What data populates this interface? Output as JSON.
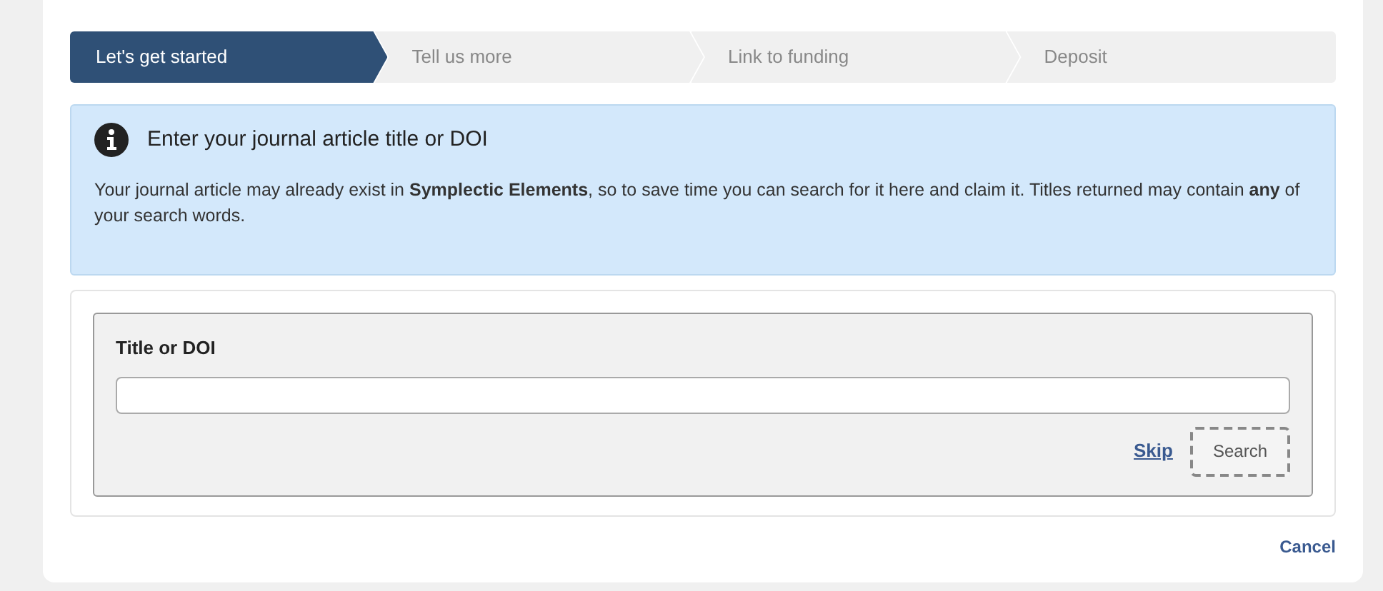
{
  "steps": [
    {
      "label": "Let's get started",
      "selected": true
    },
    {
      "label": "Tell us more",
      "selected": false
    },
    {
      "label": "Link to funding",
      "selected": false
    },
    {
      "label": "Deposit",
      "selected": false
    }
  ],
  "info": {
    "title": "Enter your journal article title or DOI",
    "text": "Your journal article may already exist in **Symplectic Elements**, so to save time you can search for it here and claim it. Titles returned may contain **any** of your search words."
  },
  "form": {
    "label": "Title or DOI",
    "skip": "Skip",
    "search": "Search"
  },
  "cancel": "Cancel"
}
